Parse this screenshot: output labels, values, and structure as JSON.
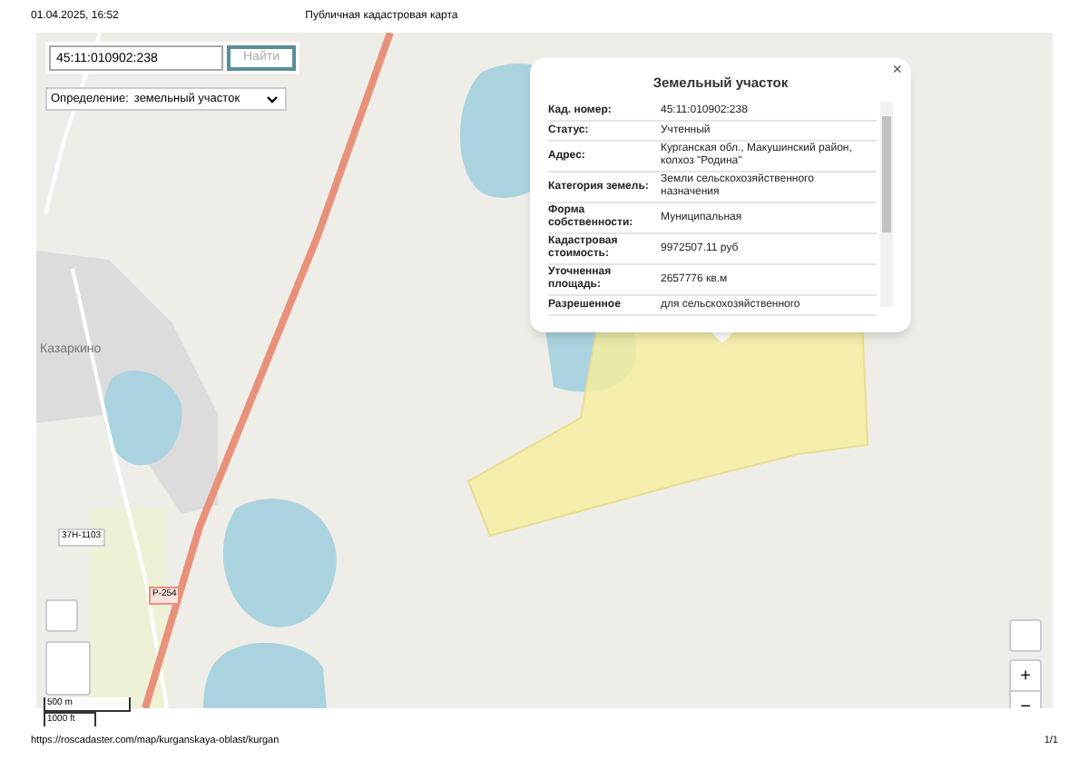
{
  "header": {
    "datetime": "01.04.2025, 16:52",
    "title": "Публичная кадастровая карта"
  },
  "search": {
    "value": "45:11:010902:238",
    "button": "Найти"
  },
  "definition": {
    "label": "Определение:",
    "value": "земельный участок"
  },
  "popup": {
    "title": "Земельный участок",
    "close": "×",
    "rows": [
      {
        "label": "Кад. номер:",
        "value": "45:11:010902:238"
      },
      {
        "label": "Статус:",
        "value": "Учтенный"
      },
      {
        "label": "Адрес:",
        "value": "Курганская обл., Макушинский район, колхоз \"Родина\""
      },
      {
        "label": "Категория земель:",
        "value": "Земли сельскохозяйственного назначения"
      },
      {
        "label": "Форма собственности:",
        "value": "Муниципальная"
      },
      {
        "label": "Кадастровая стоимость:",
        "value": "9972507.11 руб"
      },
      {
        "label": "Уточненная площадь:",
        "value": "2657776 кв.м"
      },
      {
        "label": "Разрешенное",
        "value": "для сельскохозяйственного"
      }
    ]
  },
  "map_labels": [
    {
      "text": "Казаркино",
      "kind": "place"
    },
    {
      "text": "37Н-1103",
      "kind": "road_number"
    },
    {
      "text": "Р-254",
      "kind": "highway_number"
    }
  ],
  "scale": [
    "500 m",
    "1000 ft"
  ],
  "zoom_controls": [
    "+",
    "−"
  ],
  "footer": {
    "url": "https://roscadaster.com/map/kurganskaya-oblast/kurgan",
    "page": "1/1"
  }
}
